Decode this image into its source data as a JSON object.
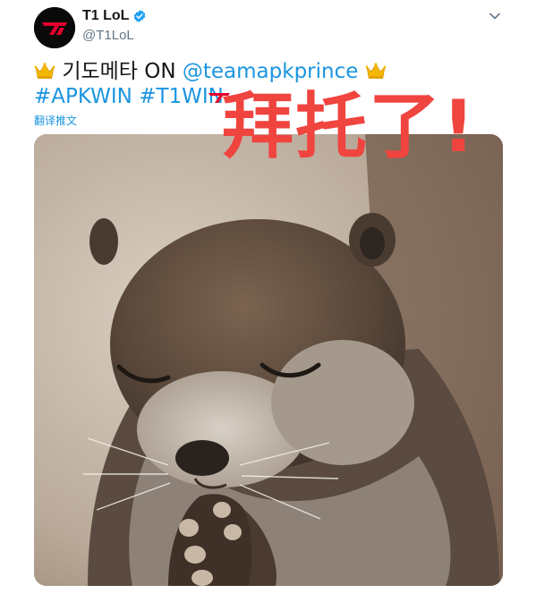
{
  "account": {
    "name": "T1 LoL",
    "handle": "@T1LoL"
  },
  "tweet": {
    "text_ko": "기도메타 ON ",
    "mention": "@teamapkprince",
    "hashtags": [
      "#APKWIN",
      "#T1WIN"
    ],
    "translate_label": "翻译推文"
  },
  "overlay": {
    "text": "拜托了!"
  },
  "icons": {
    "verified": "verified-badge-icon",
    "chevron": "chevron-down-icon",
    "crown": "crown-emoji-icon"
  },
  "colors": {
    "link": "#1b95e0",
    "overlay": "#f0443f",
    "brand": "#e2012d"
  }
}
